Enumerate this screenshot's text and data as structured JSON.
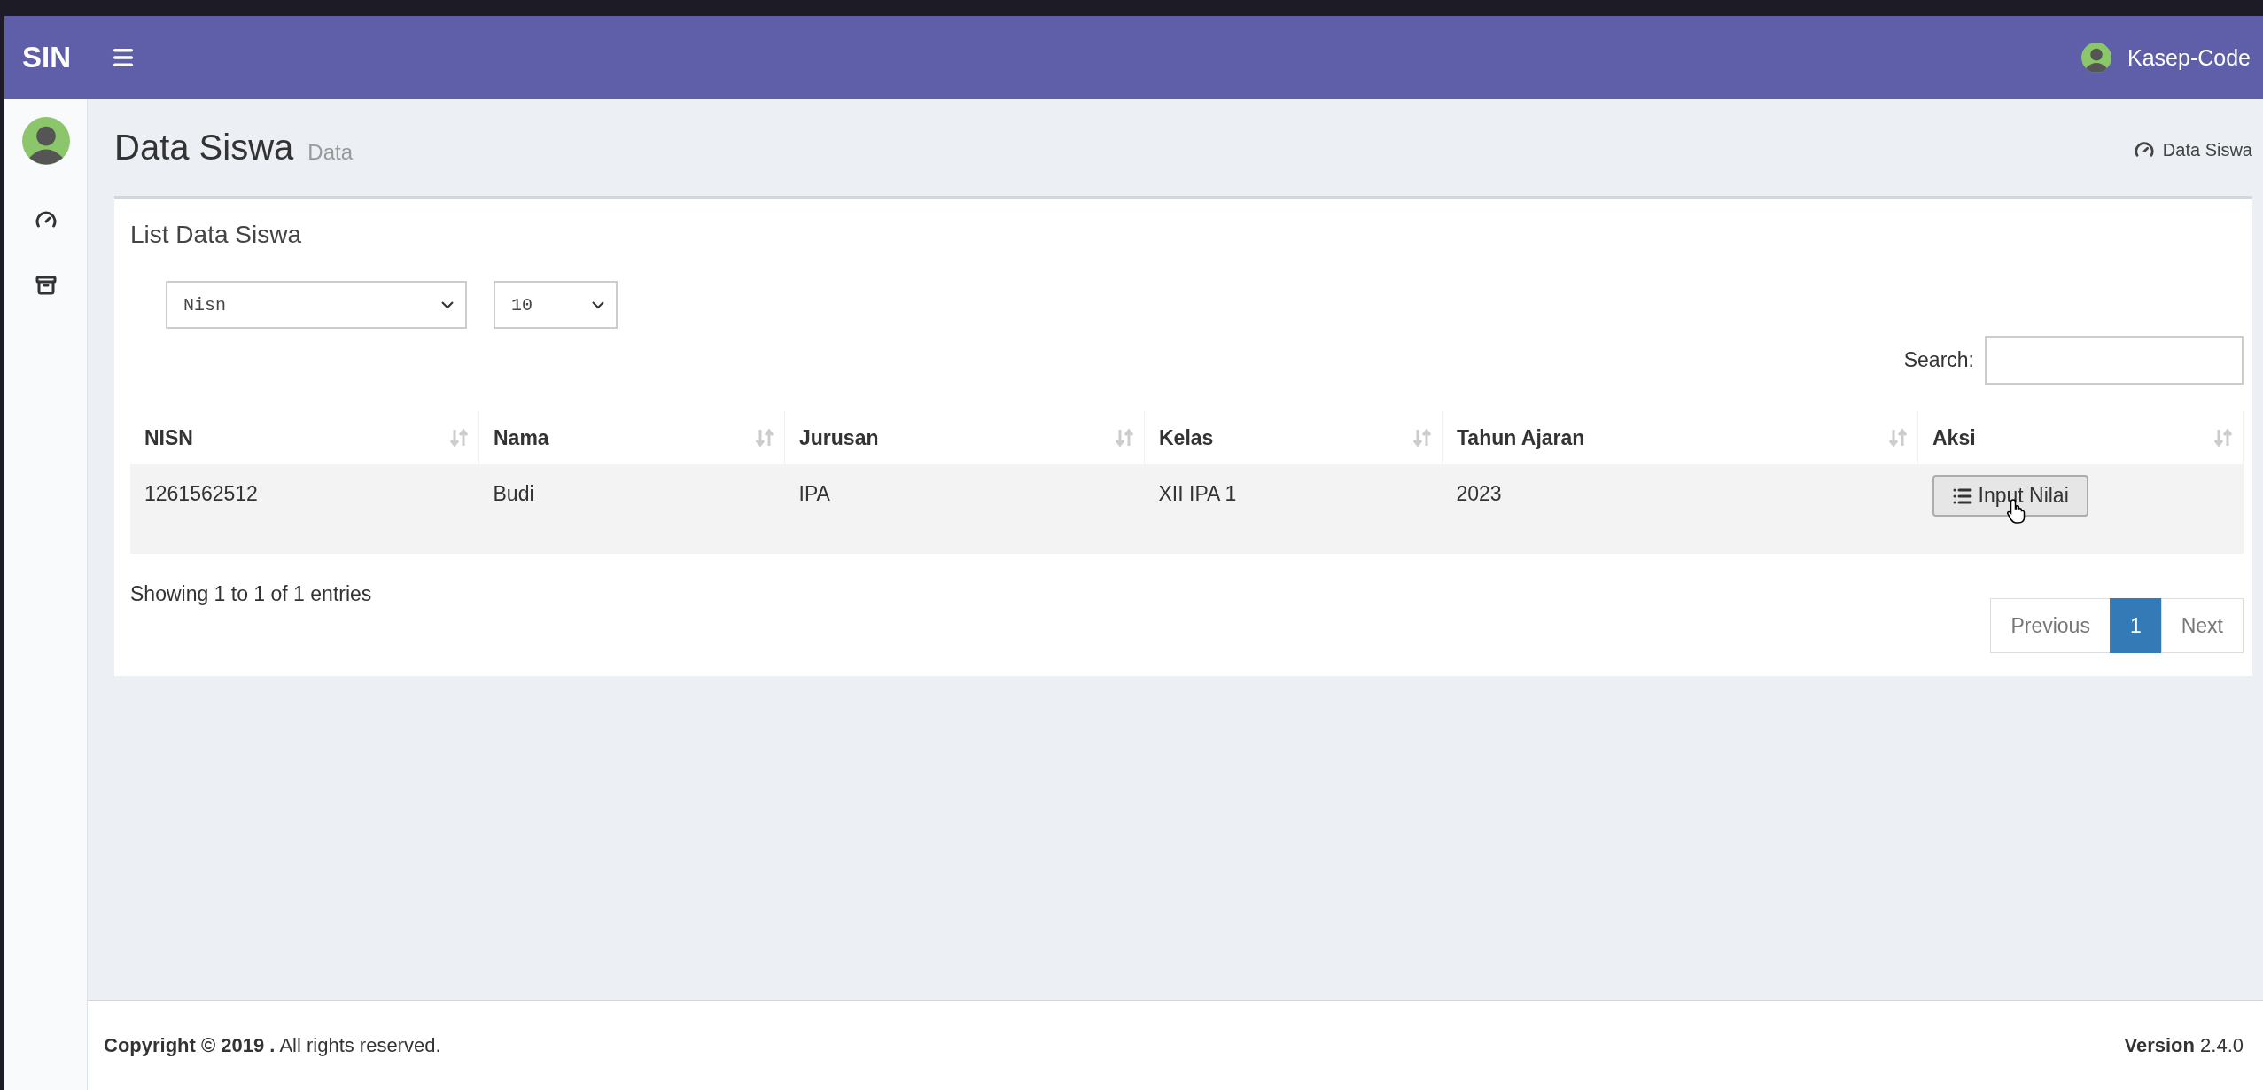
{
  "topbar": {
    "logo": "SIN",
    "user": "Kasep-Code"
  },
  "page_header": {
    "title": "Data Siswa",
    "subtitle": "Data",
    "breadcrumb": "Data Siswa"
  },
  "card": {
    "title": "List Data Siswa",
    "filter_select": {
      "value": "Nisn"
    },
    "length_select": {
      "value": "10"
    },
    "search": {
      "label": "Search:"
    },
    "table": {
      "columns": [
        "NISN",
        "Nama",
        "Jurusan",
        "Kelas",
        "Tahun Ajaran",
        "Aksi"
      ],
      "rows": [
        {
          "cells": [
            "1261562512",
            "Budi",
            "IPA",
            "XII IPA 1",
            "2023"
          ],
          "action": "Input Nilai"
        }
      ]
    },
    "info": "Showing 1 to 1 of 1 entries",
    "pagination": [
      {
        "label": "Previous",
        "selected": false
      },
      {
        "label": "1",
        "selected": true
      },
      {
        "label": "Next",
        "selected": false
      }
    ]
  },
  "footer": {
    "copyright": "**Copyright © 2019 .** All rights reserved.",
    "version": "**Version** 2.4.0"
  }
}
